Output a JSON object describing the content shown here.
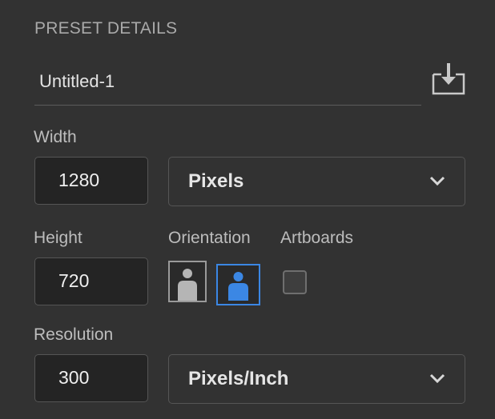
{
  "preset_details": {
    "section_title": "PRESET DETAILS",
    "document_name": "Untitled-1",
    "save_preset_icon": "save-preset-icon"
  },
  "width": {
    "label": "Width",
    "value": "1280",
    "unit": "Pixels"
  },
  "height": {
    "label": "Height",
    "value": "720"
  },
  "orientation": {
    "label": "Orientation",
    "options": [
      "portrait",
      "landscape"
    ],
    "selected": "landscape"
  },
  "artboards": {
    "label": "Artboards",
    "checked": false
  },
  "resolution": {
    "label": "Resolution",
    "value": "300",
    "unit": "Pixels/Inch"
  },
  "colors": {
    "panel_bg": "#323232",
    "field_bg": "#242424",
    "accent": "#3b87e4"
  }
}
